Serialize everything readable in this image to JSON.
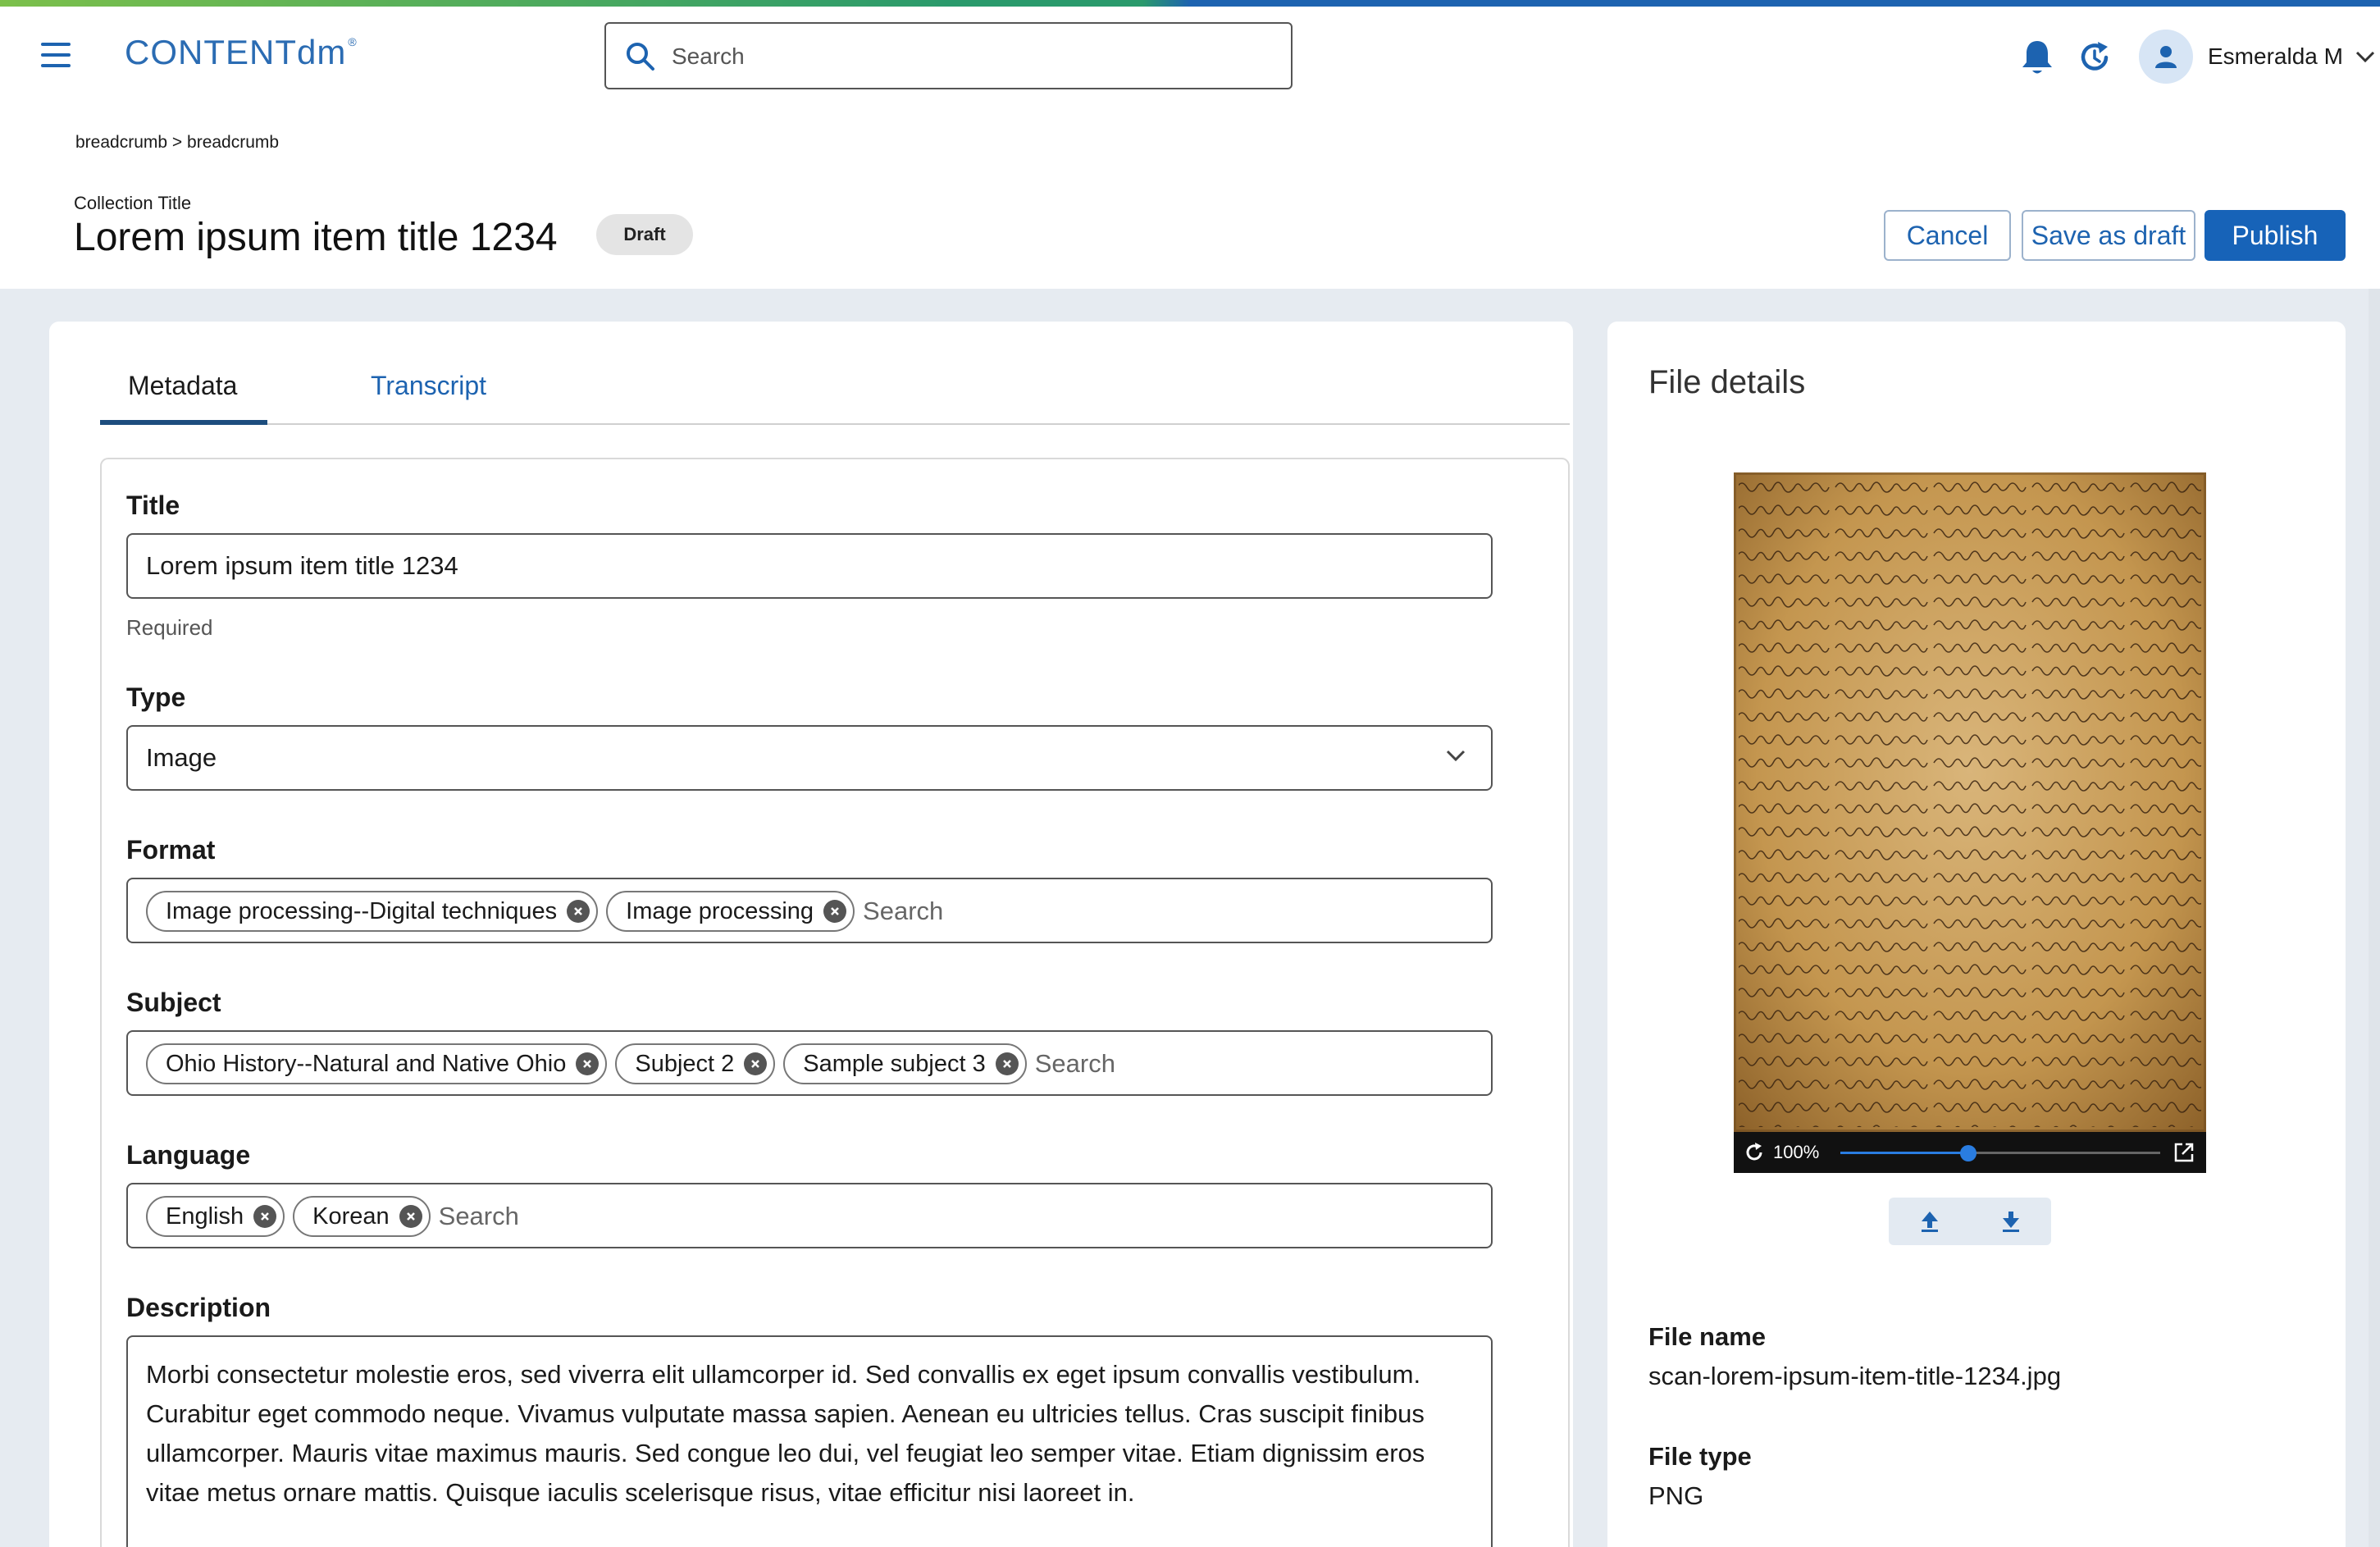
{
  "app": {
    "logo_text": "CONTENTdm",
    "logo_mark": "®"
  },
  "header": {
    "search_placeholder": "Search",
    "user_name": "Esmeralda M",
    "icons": [
      "menu-icon",
      "search-icon",
      "bell-icon",
      "refresh-icon",
      "user-icon",
      "chevron-down-icon"
    ]
  },
  "breadcrumb": {
    "items": [
      "breadcrumb",
      "breadcrumb"
    ],
    "separator": ">"
  },
  "page": {
    "collection_title": "Collection Title",
    "title": "Lorem ipsum item title 1234",
    "status_badge": "Draft"
  },
  "actions": {
    "cancel": "Cancel",
    "save_draft": "Save as draft",
    "publish": "Publish"
  },
  "tabs": [
    {
      "label": "Metadata",
      "active": true
    },
    {
      "label": "Transcript",
      "active": false
    }
  ],
  "form": {
    "title": {
      "label": "Title",
      "value": "Lorem ipsum item title 1234",
      "hint": "Required"
    },
    "type": {
      "label": "Type",
      "value": "Image"
    },
    "format": {
      "label": "Format",
      "chips": [
        "Image processing--Digital techniques",
        "Image processing"
      ],
      "placeholder": "Search"
    },
    "subject": {
      "label": "Subject",
      "chips": [
        "Ohio History--Natural and Native Ohio",
        "Subject 2",
        "Sample subject 3"
      ],
      "placeholder": "Search"
    },
    "language": {
      "label": "Language",
      "chips": [
        "English",
        "Korean"
      ],
      "placeholder": "Search"
    },
    "description": {
      "label": "Description",
      "value": "Morbi consectetur molestie eros, sed viverra elit ullamcorper id. Sed convallis ex eget ipsum convallis vestibulum. Curabitur eget commodo neque. Vivamus vulputate massa sapien. Aenean eu ultricies tellus. Cras suscipit finibus ullamcorper. Mauris vitae maximus mauris. Sed congue leo dui, vel feugiat leo semper vitae. Etiam dignissim eros vitae metus ornare mattis. Quisque iaculis scelerisque risus, vitae efficitur nisi laoreet in."
    }
  },
  "file_details": {
    "heading": "File details",
    "zoom": "100%",
    "zoom_slider_fraction": 0.4,
    "file_name_label": "File name",
    "file_name": "scan-lorem-ipsum-item-title-1234.jpg",
    "file_type_label": "File type",
    "file_type": "PNG"
  },
  "colors": {
    "accent": "#1763b8",
    "link": "#1d63b0",
    "page_bg": "#e6ebf1",
    "badge_bg": "#e4e4e4"
  }
}
